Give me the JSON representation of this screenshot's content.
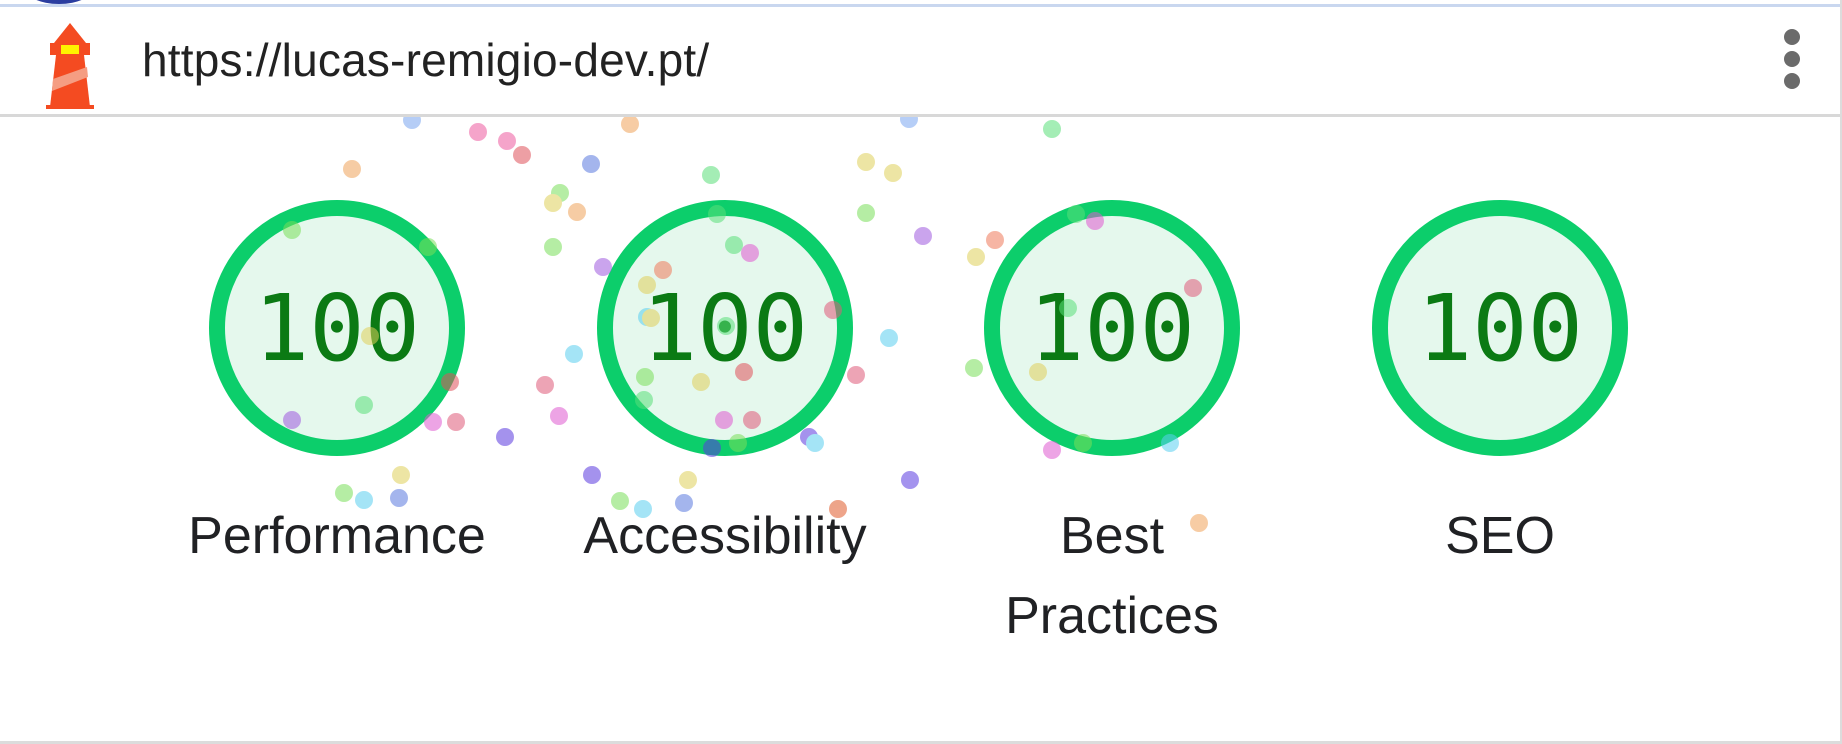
{
  "header": {
    "url": "https://lucas-remigio-dev.pt/"
  },
  "icons": {
    "logo": "lighthouse-icon",
    "menu": "more-vertical-icon"
  },
  "colors": {
    "pass_ring": "#0cce6b",
    "pass_fill": "#e5f8ed",
    "pass_text": "#0b7a14"
  },
  "gauges": [
    {
      "label": "Performance",
      "score": "100"
    },
    {
      "label": "Accessibility",
      "score": "100"
    },
    {
      "label": "Best Practices",
      "score": "100"
    },
    {
      "label": "SEO",
      "score": "100"
    }
  ]
}
